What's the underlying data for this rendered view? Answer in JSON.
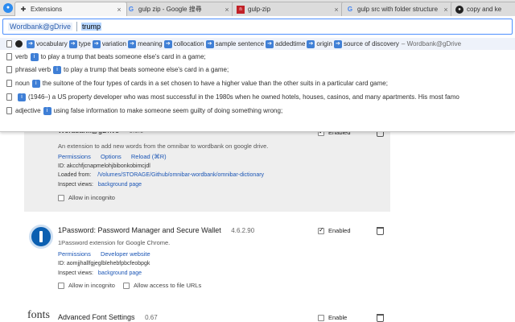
{
  "tabs": [
    {
      "title": "Extensions",
      "icon": "puzzle-icon",
      "active": true
    },
    {
      "title": "gulp zip - Google 搜尋",
      "icon": "google-icon"
    },
    {
      "title": "gulp-zip",
      "icon": "npm-icon"
    },
    {
      "title": "gulp src with folder structure",
      "icon": "google-icon"
    },
    {
      "title": "copy and ke",
      "icon": "github-icon"
    }
  ],
  "omnibox": {
    "keyword": "Wordbank@gDrive",
    "query": "trump"
  },
  "suggestions": {
    "header": {
      "items": [
        "vocabulary",
        "type",
        "variation",
        "meaning",
        "collocation",
        "sample sentence",
        "addedtime",
        "origin",
        "source of discovery"
      ],
      "source": "– Wordbank@gDrive"
    },
    "rows": [
      {
        "pos": "verb",
        "text": "to play a trump that beats someone else's card in a game;"
      },
      {
        "pos": "phrasal verb",
        "text": "to play a trump that beats someone else's card in a game;"
      },
      {
        "pos": "noun",
        "text": "the suitone of the four types of cards in a set chosen to have a higher value than the other suits in a particular card game;"
      },
      {
        "pos": "",
        "text": "(1946–) a US property developer who was most successful in the 1980s when he owned hotels, houses, casinos, and many apartments. His most famo"
      },
      {
        "pos": "adjective",
        "text": "using false information to make someone seem guilty of doing something wrong;"
      }
    ],
    "badge": "i"
  },
  "extensions": [
    {
      "title": "Wordbank@gDrive",
      "version": "0.0.0",
      "description": "An extension to add new words from the omnibar to wordbank on google drive.",
      "links": [
        "Permissions",
        "Options",
        "Reload (⌘R)"
      ],
      "id_label": "ID: akcchfjcnapmelohjbibonkobimcjdl",
      "loaded_label": "Loaded from:",
      "loaded_path": "/Volumes/STORAGE/Github/omnibar-wordbank/omnibar-dictionary",
      "inspect_label": "Inspect views:",
      "inspect_link": "background page",
      "incognito_label": "Allow in incognito",
      "enabled_label": "Enabled",
      "enabled": true
    },
    {
      "title": "1Password: Password Manager and Secure Wallet",
      "version": "4.6.2.90",
      "description": "1Password extension for Google Chrome.",
      "links": [
        "Permissions",
        "Developer website"
      ],
      "id_label": "ID: aomjjhallfgjeglblehebfpbcfeobpgk",
      "inspect_label": "Inspect views:",
      "inspect_link": "background page",
      "incognito_label": "Allow in incognito",
      "file_urls_label": "Allow access to file URLs",
      "enabled_label": "Enabled",
      "enabled": true
    },
    {
      "title": "Advanced Font Settings",
      "version": "0.67",
      "logo_text": "fonts",
      "enabled_label": "Enable",
      "enabled": false
    }
  ]
}
